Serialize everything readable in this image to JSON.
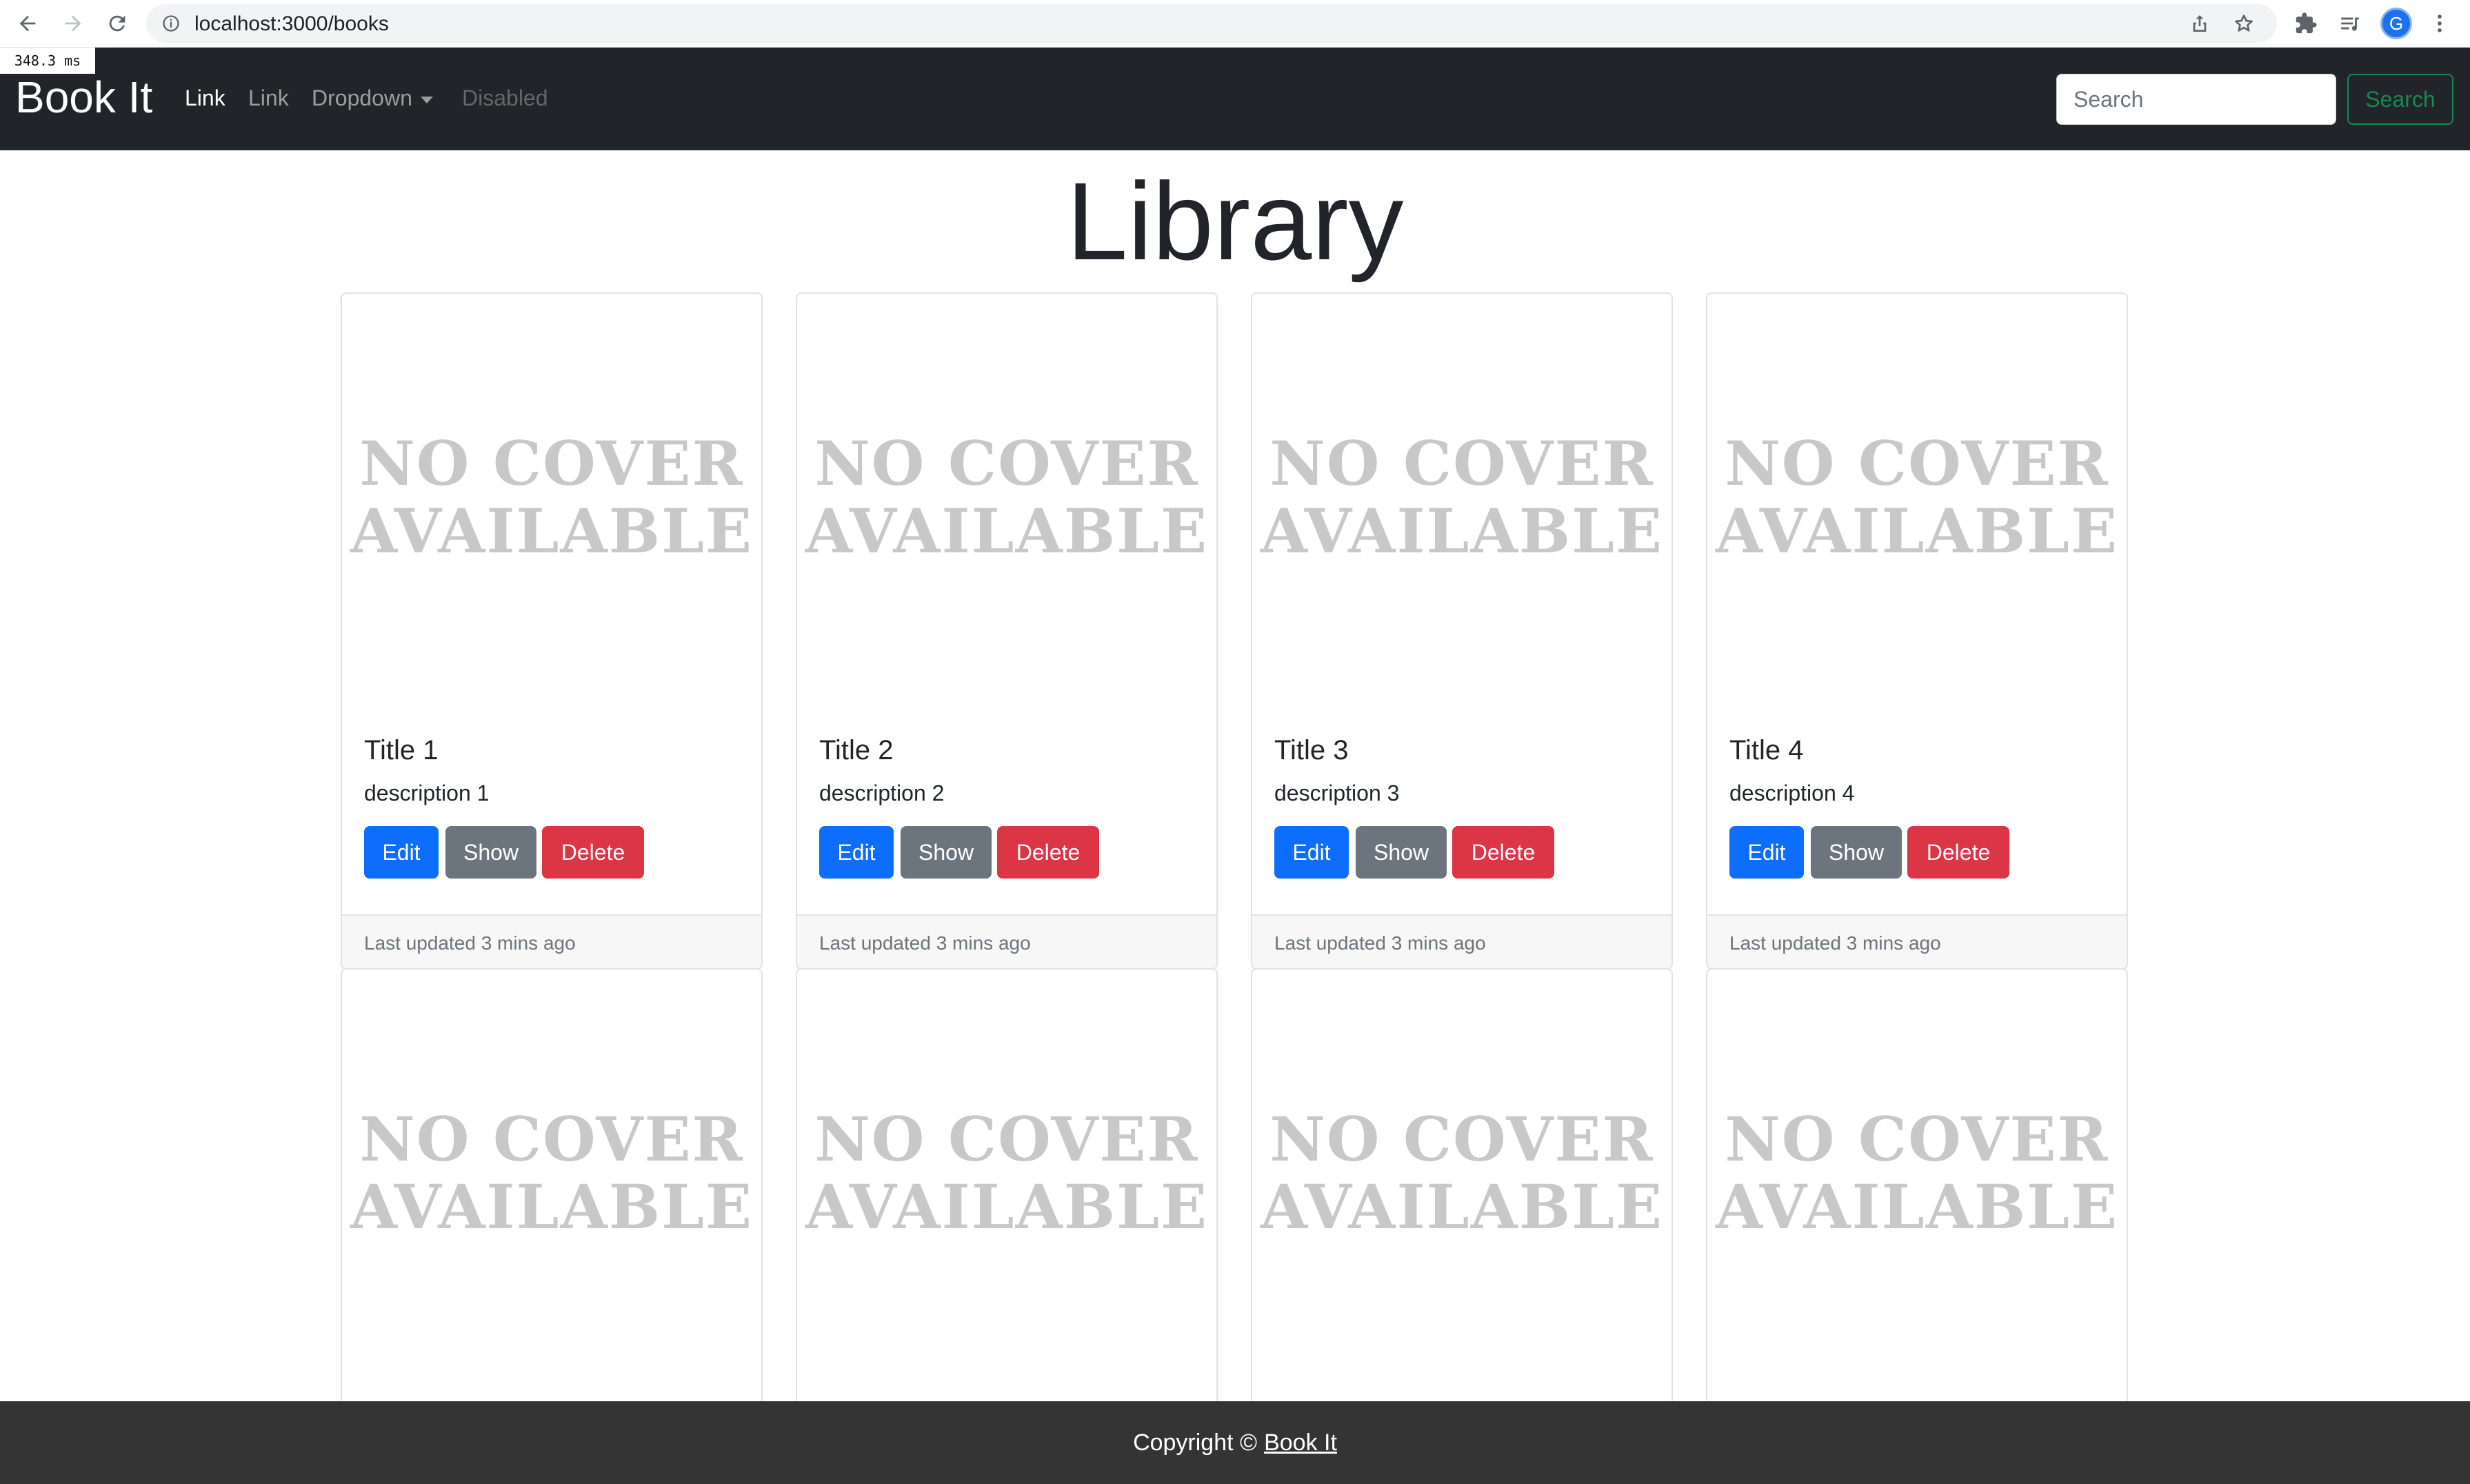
{
  "browser": {
    "url": "localhost:3000/books",
    "profile_initial": "G",
    "timing": "348.3 ms"
  },
  "navbar": {
    "brand": "Book It",
    "links": [
      {
        "label": "Link",
        "state": "active"
      },
      {
        "label": "Link",
        "state": "normal"
      },
      {
        "label": "Dropdown",
        "state": "dropdown"
      },
      {
        "label": "Disabled",
        "state": "disabled"
      }
    ],
    "search_placeholder": "Search",
    "search_button": "Search"
  },
  "main": {
    "title": "Library",
    "cover_placeholder_line1": "NO COVER",
    "cover_placeholder_line2": "AVAILABLE",
    "books": [
      {
        "title": "Title 1",
        "description": "description 1",
        "updated": "Last updated 3 mins ago"
      },
      {
        "title": "Title 2",
        "description": "description 2",
        "updated": "Last updated 3 mins ago"
      },
      {
        "title": "Title 3",
        "description": "description 3",
        "updated": "Last updated 3 mins ago"
      },
      {
        "title": "Title 4",
        "description": "description 4",
        "updated": "Last updated 3 mins ago"
      }
    ],
    "buttons": {
      "edit": "Edit",
      "show": "Show",
      "delete": "Delete"
    }
  },
  "footer": {
    "prefix": "Copyright ©",
    "link": "Book It"
  },
  "colors": {
    "navbar_bg": "#212529",
    "primary": "#0d6efd",
    "secondary": "#6c757d",
    "danger": "#dc3545",
    "success": "#198754",
    "footer_bg": "#343434"
  }
}
